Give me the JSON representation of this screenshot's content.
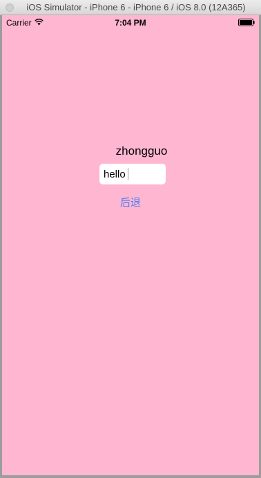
{
  "window": {
    "title": "iOS Simulator - iPhone 6 - iPhone 6 / iOS 8.0 (12A365)"
  },
  "statusbar": {
    "carrier": "Carrier",
    "time": "7:04 PM"
  },
  "main": {
    "label": "zhongguo",
    "text_field_value": "hello",
    "back_button": "后退"
  },
  "colors": {
    "screen_background": "#ffb6d1",
    "button_tint": "#4a7cf5"
  }
}
